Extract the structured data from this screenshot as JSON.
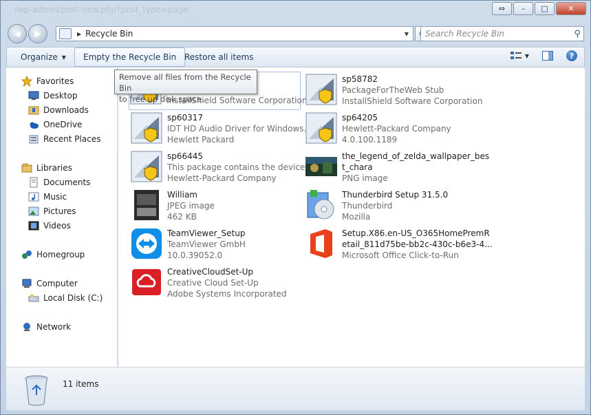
{
  "window": {
    "bg_fragment": "/wp-admin/post-new.php?post_type=page"
  },
  "nav": {
    "location": "Recycle Bin",
    "search_placeholder": "Search Recycle Bin"
  },
  "toolbar": {
    "organize": "Organize",
    "empty": "Empty the Recycle Bin",
    "restore": "Restore all items"
  },
  "tooltip": {
    "line1": "Remove all files from the Recycle Bin",
    "line2": "to free up disk space."
  },
  "sidebar": {
    "favorites": "Favorites",
    "desktop": "Desktop",
    "downloads": "Downloads",
    "onedrive": "OneDrive",
    "recent": "Recent Places",
    "libraries": "Libraries",
    "documents": "Documents",
    "music": "Music",
    "pictures": "Pictures",
    "videos": "Videos",
    "homegroup": "Homegroup",
    "computer": "Computer",
    "localdisk": "Local Disk (C:)",
    "network": "Network"
  },
  "items": [
    {
      "name": "",
      "l2": "",
      "l3": "InstallShield Software Corporation",
      "icon": "installer-icon"
    },
    {
      "name": "sp58782",
      "l2": "PackageForTheWeb Stub",
      "l3": "InstallShield Software Corporation",
      "icon": "installer-icon"
    },
    {
      "name": "sp60317",
      "l2": "IDT HD Audio Driver for Windows...",
      "l3": "Hewlett Packard",
      "icon": "installer-icon"
    },
    {
      "name": "sp64205",
      "l2": "Hewlett-Packard Company",
      "l3": "4.0.100.1189",
      "icon": "installer-icon"
    },
    {
      "name": "sp66445",
      "l2": "This package contains the device ...",
      "l3": "Hewlett-Packard Company",
      "icon": "installer-icon"
    },
    {
      "name": "the_legend_of_zelda_wallpaper_bes",
      "l2": "t_chara",
      "l3": "PNG image",
      "icon": "image-thumbnail-icon"
    },
    {
      "name": "William",
      "l2": "JPEG image",
      "l3": "462 KB",
      "icon": "photo-thumbnail-icon"
    },
    {
      "name": "Thunderbird Setup 31.5.0",
      "l2": "Thunderbird",
      "l3": "Mozilla",
      "icon": "setup-disc-icon"
    },
    {
      "name": "TeamViewer_Setup",
      "l2": "TeamViewer GmbH",
      "l3": "10.0.39052.0",
      "icon": "teamviewer-icon"
    },
    {
      "name": "Setup.X86.en-US_O365HomePremR",
      "l2": "etail_811d75be-bb2c-430c-b6e3-4...",
      "l3": "Microsoft Office Click-to-Run",
      "icon": "office-icon"
    },
    {
      "name": "CreativeCloudSet-Up",
      "l2": "Creative Cloud Set-Up",
      "l3": "Adobe Systems Incorporated",
      "icon": "creative-cloud-icon"
    }
  ],
  "status": {
    "count": "11 items"
  },
  "colors": {
    "accent": "#1e395b",
    "selection": "#a7c3e3"
  }
}
